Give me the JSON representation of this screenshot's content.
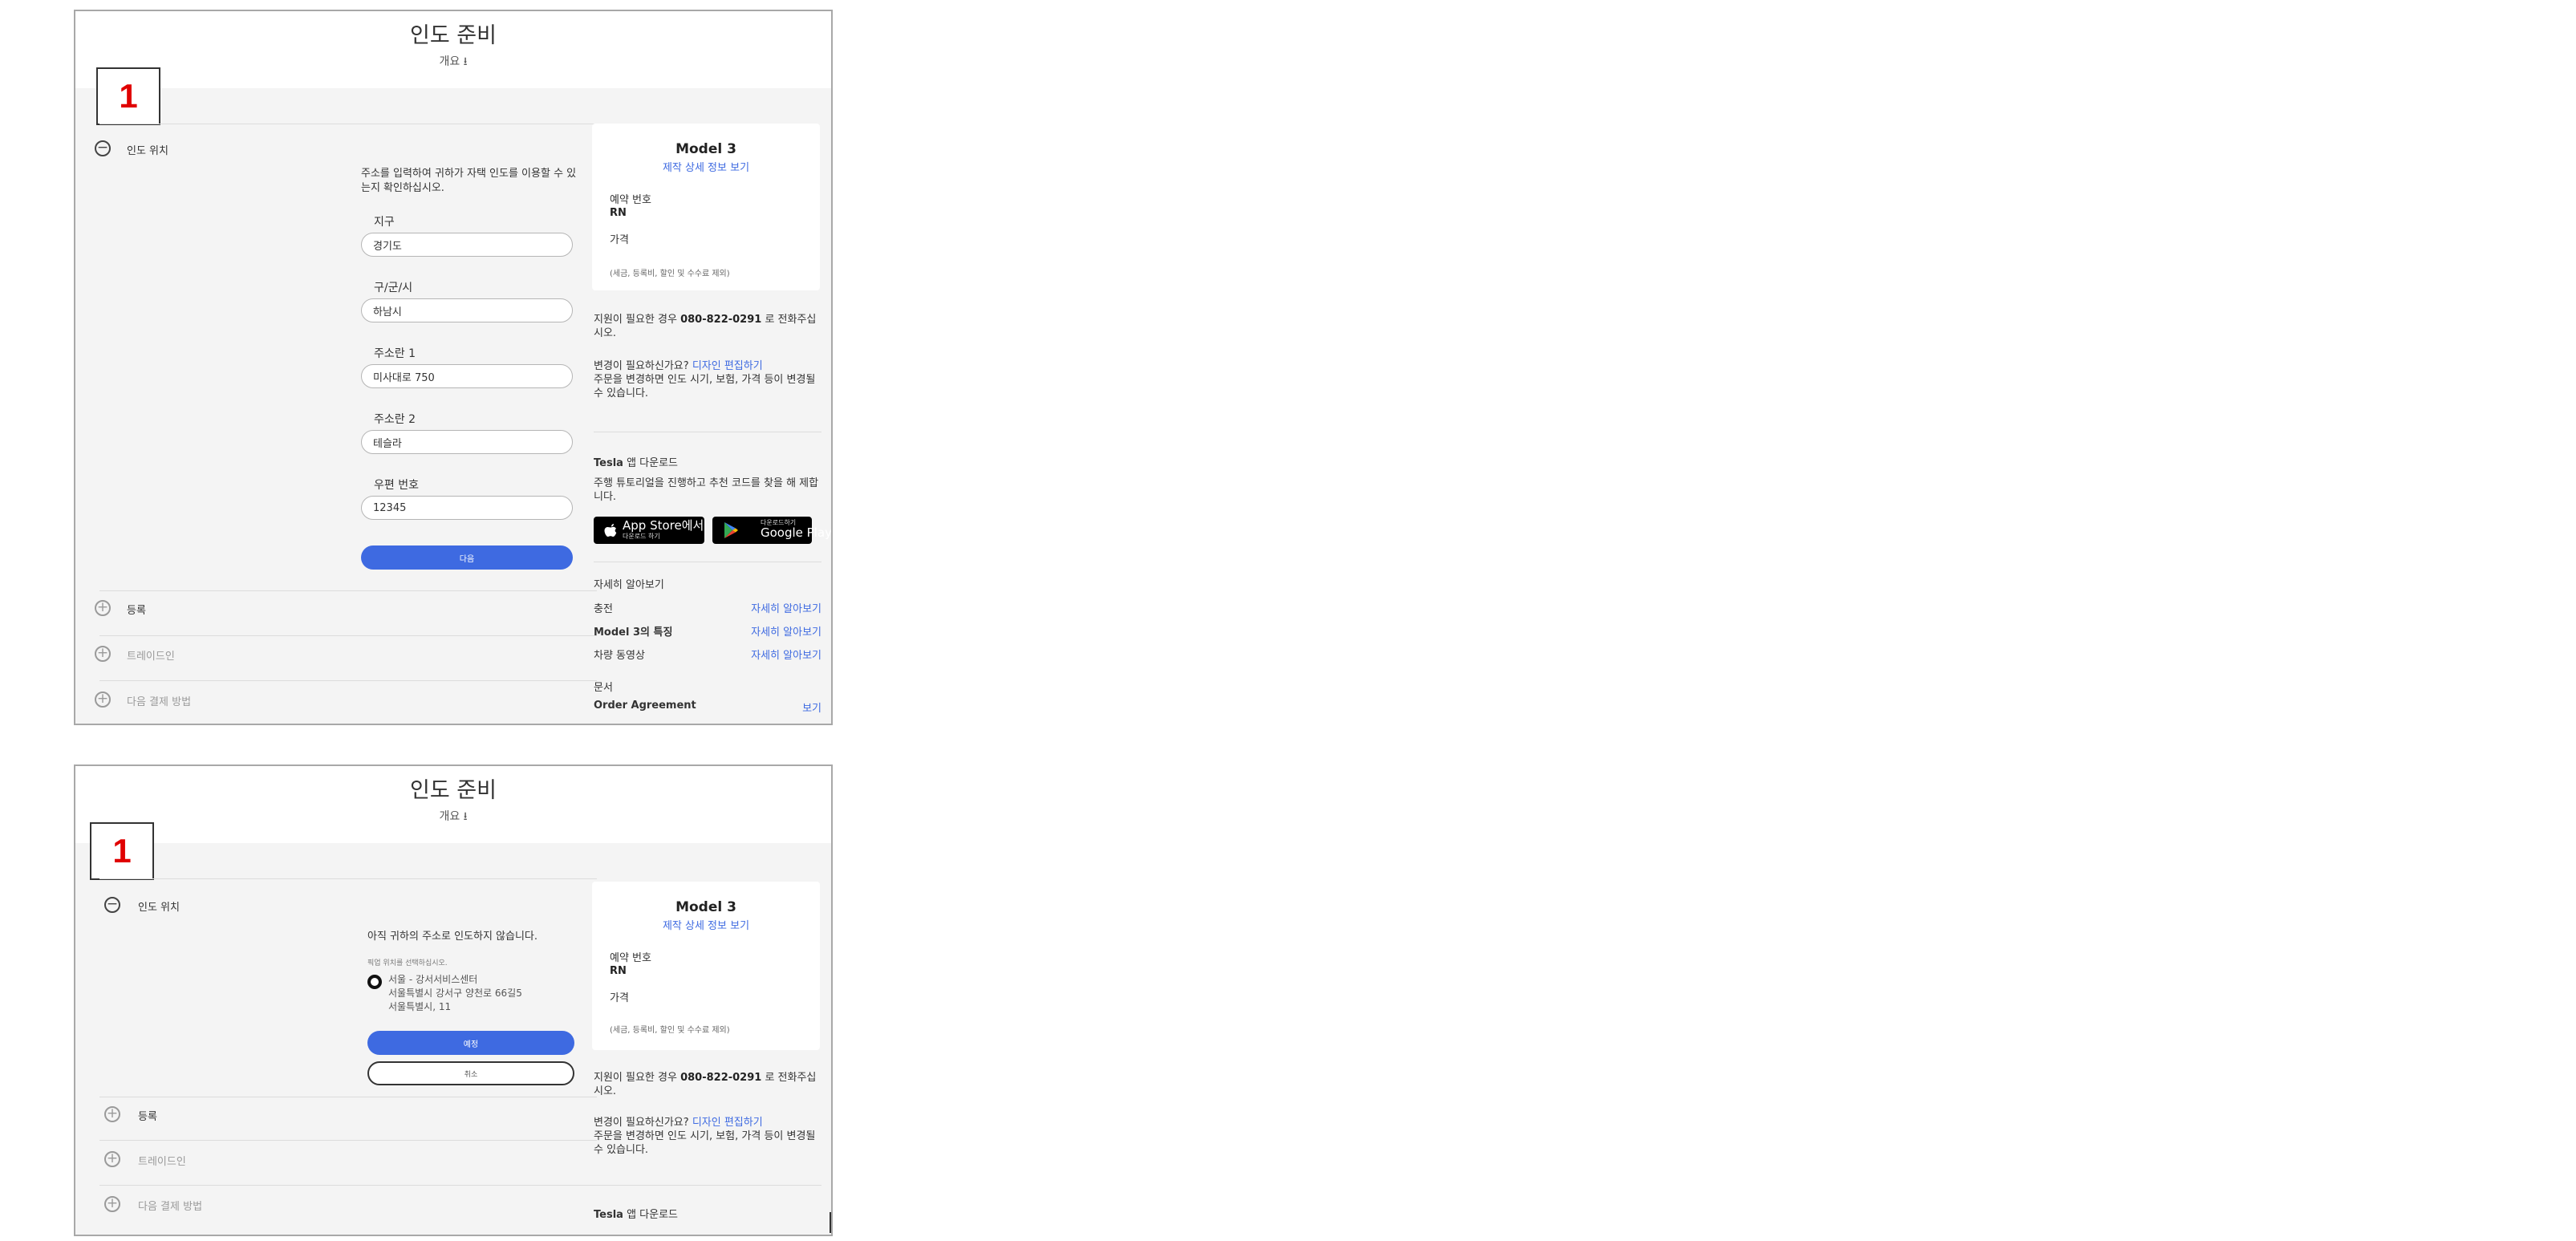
{
  "page": {
    "title": "인도 준비",
    "overview": "개요 ⭳",
    "step_number": "1"
  },
  "accordion": {
    "delivery_location": "인도 위치",
    "registration": "등록",
    "trade_in": "트레이드인",
    "final_payment": "다음 결제 방법"
  },
  "form": {
    "intro": "주소를 입력하여 귀하가 자택 인도를 이용할 수 있는지 확인하십시오.",
    "fields": [
      {
        "label": "지구",
        "value": "경기도"
      },
      {
        "label": "구/군/시",
        "value": "하남시"
      },
      {
        "label": "주소란 1",
        "value": "미사대로 750"
      },
      {
        "label": "주소란 2",
        "value": "테슬라"
      },
      {
        "label": "우편 번호",
        "value": "12345"
      }
    ],
    "next_button": "다음"
  },
  "location_select": {
    "message": "아직 귀하의 주소로 인도하지 않습니다.",
    "hint": "픽업 위치를 선택하십시오.",
    "option_name": "서울 - 강서서비스센터",
    "option_address1": "서울특별시 강서구 양천로 66길5",
    "option_address2": "서울특별시, 11",
    "confirm_button": "예정",
    "cancel_button": "취소"
  },
  "order_card": {
    "model": "Model 3",
    "details_link": "제작 상세 정보 보기",
    "reservation_label": "예약 번호",
    "reservation_value": "RN",
    "price_label": "가격",
    "price_note": "(세금, 등록비, 할인 및 수수료 제외)"
  },
  "support": {
    "text_before": "지원이 필요한 경우 ",
    "phone": "080-822-0291",
    "text_after": " 로 전화주십시오."
  },
  "changes": {
    "question": "변경이 필요하신가요? ",
    "link": "디자인 편집하기",
    "text": "주문을 변경하면 인도 시기, 보험, 가격 등이 변경될 수 있습니다."
  },
  "app_download": {
    "brand": "Tesla",
    "title_suffix": " 앱 다운로드",
    "text": "주행 튜토리얼을 진행하고 추천 코드를 찾을 해 제합니다.",
    "app_store_main": "App Store에서",
    "app_store_sub": "다운로드 하기",
    "google_play_sub": "다운로드하기",
    "google_play_main": "Google Play"
  },
  "learn_more": {
    "title": "자세히 알아보기",
    "rows": [
      {
        "label": "충전",
        "link": "자세히 알아보기"
      },
      {
        "label": "Model 3의 특징",
        "link": "자세히 알아보기"
      },
      {
        "label": "차량 동영상",
        "link": "자세히 알아보기"
      }
    ]
  },
  "documents": {
    "title": "문서",
    "order_agreement": "Order Agreement",
    "view_link": "보기"
  },
  "colors": {
    "accent": "#3e6ae1",
    "step_number": "#e00000",
    "panel_background": "#f4f4f4"
  }
}
